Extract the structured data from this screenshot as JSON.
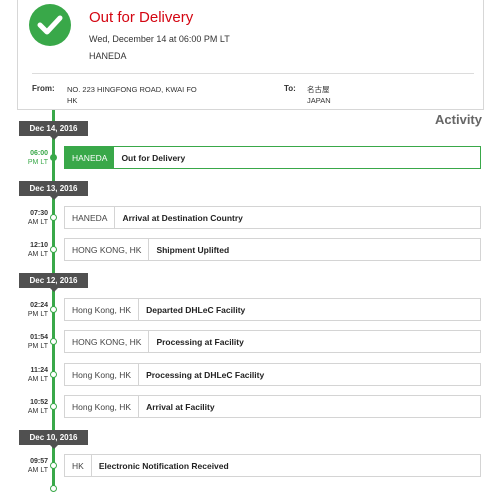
{
  "colors": {
    "accent": "#39a849",
    "status_red": "#d40511",
    "badge": "#505050"
  },
  "summary": {
    "icon": "checkmark-icon",
    "status": "Out for Delivery",
    "date": "Wed, December 14 at 06:00 PM LT",
    "location": "HANEDA",
    "from_label": "From:",
    "from_line1": "NO. 223 HINGFONG ROAD, KWAI FO",
    "from_line2": "HK",
    "to_label": "To:",
    "to_line1": "名古屋",
    "to_line2": "JAPAN"
  },
  "activity_title": "Activity",
  "dates": [
    "Dec 14, 2016",
    "Dec 13, 2016",
    "Dec 12, 2016",
    "Dec 10, 2016"
  ],
  "events": [
    {
      "time": "06:00",
      "ampm": "PM LT",
      "location": "HANEDA",
      "description": "Out for Delivery",
      "active": true
    },
    {
      "time": "07:30",
      "ampm": "AM LT",
      "location": "HANEDA",
      "description": "Arrival at Destination Country"
    },
    {
      "time": "12:10",
      "ampm": "AM LT",
      "location": "HONG KONG, HK",
      "description": "Shipment Uplifted"
    },
    {
      "time": "02:24",
      "ampm": "PM LT",
      "location": "Hong Kong, HK",
      "description": "Departed DHLeC Facility"
    },
    {
      "time": "01:54",
      "ampm": "PM LT",
      "location": "HONG KONG, HK",
      "description": "Processing at Facility"
    },
    {
      "time": "11:24",
      "ampm": "AM LT",
      "location": "Hong Kong, HK",
      "description": "Processing at DHLeC Facility"
    },
    {
      "time": "10:52",
      "ampm": "AM LT",
      "location": "Hong Kong, HK",
      "description": "Arrival at Facility"
    },
    {
      "time": "09:57",
      "ampm": "AM LT",
      "location": "HK",
      "description": "Electronic Notification Received"
    }
  ]
}
